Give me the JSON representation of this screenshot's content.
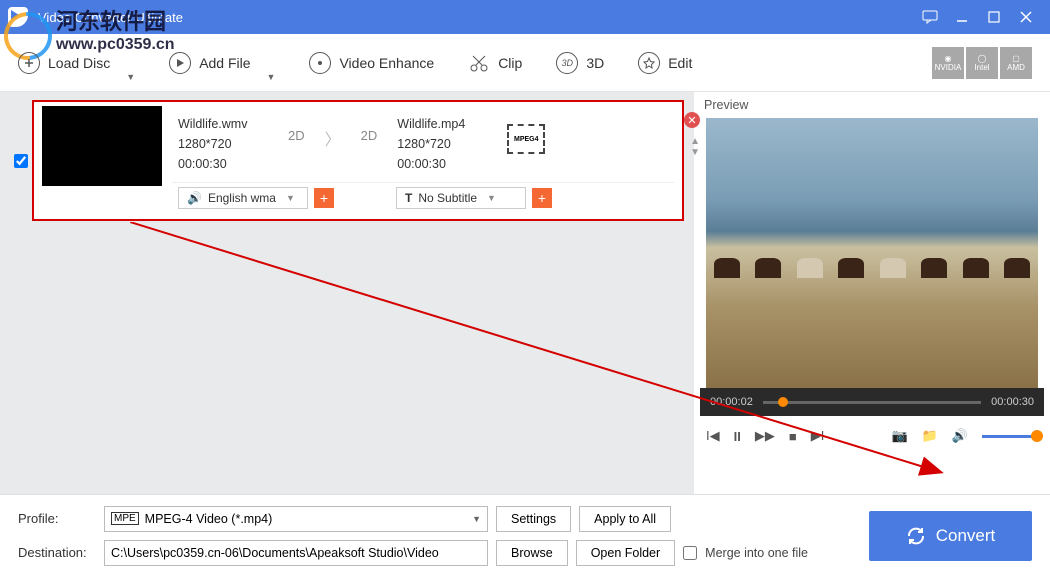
{
  "titlebar": {
    "title": "Video Converter Ultimate"
  },
  "watermark": {
    "line1": "河东软件园",
    "line2": "www.pc0359.cn"
  },
  "toolbar": {
    "load_disc": "Load Disc",
    "add_file": "Add File",
    "video_enhance": "Video Enhance",
    "clip": "Clip",
    "three_d": "3D",
    "edit": "Edit",
    "gpu": {
      "nvidia": "NVIDIA",
      "intel": "Intel",
      "amd": "AMD"
    }
  },
  "file": {
    "src_name": "Wildlife.wmv",
    "src_res": "1280*720",
    "src_dur": "00:00:30",
    "badge_src": "2D",
    "badge_dst": "2D",
    "dst_name": "Wildlife.mp4",
    "dst_res": "1280*720",
    "dst_dur": "00:00:30",
    "format_label": "MPEG4",
    "audio_track": "English wma",
    "subtitle": "No Subtitle"
  },
  "preview": {
    "title": "Preview",
    "time_cur": "00:00:02",
    "time_total": "00:00:30"
  },
  "bottom": {
    "profile_label": "Profile:",
    "profile_value": "MPEG-4 Video (*.mp4)",
    "settings": "Settings",
    "apply_all": "Apply to All",
    "dest_label": "Destination:",
    "dest_value": "C:\\Users\\pc0359.cn-06\\Documents\\Apeaksoft Studio\\Video",
    "browse": "Browse",
    "open_folder": "Open Folder",
    "merge": "Merge into one file",
    "convert": "Convert"
  }
}
